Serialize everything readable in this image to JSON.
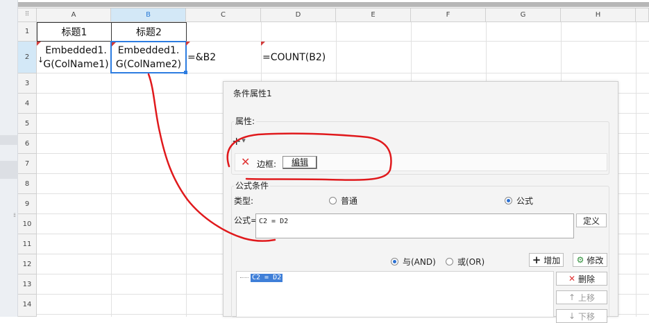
{
  "grid": {
    "columns": [
      "A",
      "B",
      "C",
      "D",
      "E",
      "F",
      "G",
      "H"
    ],
    "rows": [
      "1",
      "2",
      "3",
      "4",
      "5",
      "6",
      "7",
      "8",
      "9",
      "10",
      "11",
      "12",
      "13",
      "14"
    ],
    "cells": {
      "a1": "标题1",
      "b1": "标题2",
      "a2_line1": "Embedded1.",
      "a2_line2": "G(ColName1)",
      "b2_line1": "Embedded1.",
      "b2_line2": "G(ColName2)",
      "c2": "=&B2",
      "d2": "=COUNT(B2)"
    },
    "a2_arrow": "↓"
  },
  "dialog": {
    "title": "条件属性1",
    "attributes": {
      "label": "属性:",
      "add_symbol": "+",
      "border_label": "边框:",
      "edit_button": "编辑"
    },
    "formula_condition": {
      "group_label": "公式条件",
      "type_label": "类型:",
      "type_options": [
        {
          "label": "普通",
          "selected": false
        },
        {
          "label": "公式",
          "selected": true
        }
      ],
      "formula_label": "公式=",
      "formula_value": "C2 = D2",
      "define_button": "定义",
      "logic_options": [
        {
          "label": "与(AND)",
          "selected": true
        },
        {
          "label": "或(OR)",
          "selected": false
        }
      ],
      "add_button": "增加",
      "modify_button": "修改",
      "delete_button": "删除",
      "up_button": "上移",
      "down_button": "下移",
      "conditions": [
        "C2 = D2"
      ]
    }
  },
  "colors": {
    "selection": "#2c7ce0",
    "annotation": "#e0191c",
    "flag": "#d23a3a"
  }
}
